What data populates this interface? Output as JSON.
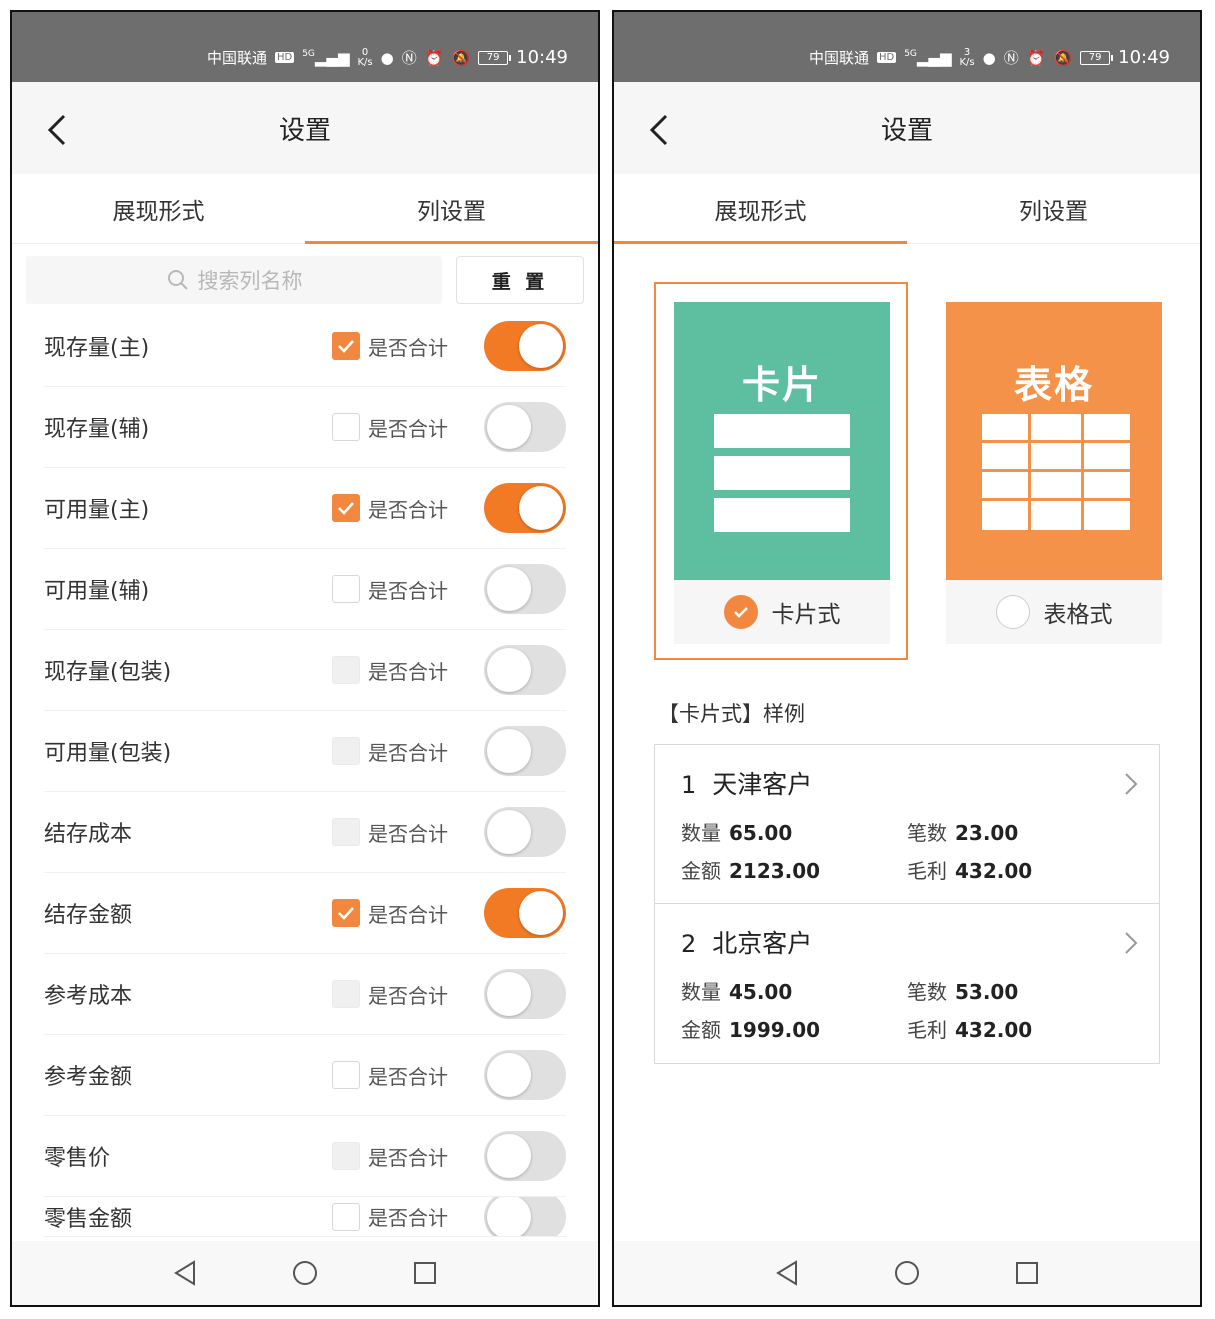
{
  "status_bar": {
    "carrier": "中国联通",
    "hd": "HD",
    "net": "5G",
    "left_speed_top": "0",
    "right_speed_top": "3",
    "speed_unit": "K/s",
    "battery": "79",
    "time": "10:49"
  },
  "header": {
    "title": "设置"
  },
  "tabs": {
    "display_mode": "展现形式",
    "column_settings": "列设置"
  },
  "column_settings": {
    "search_placeholder": "搜索列名称",
    "reset_label": "重 置",
    "sum_label": "是否合计",
    "columns": [
      {
        "name": "现存量(主)",
        "sum": "checked",
        "enabled": true
      },
      {
        "name": "现存量(辅)",
        "sum": "unchecked",
        "enabled": false
      },
      {
        "name": "可用量(主)",
        "sum": "checked",
        "enabled": true
      },
      {
        "name": "可用量(辅)",
        "sum": "unchecked",
        "enabled": false
      },
      {
        "name": "现存量(包装)",
        "sum": "disabled",
        "enabled": false
      },
      {
        "name": "可用量(包装)",
        "sum": "disabled",
        "enabled": false
      },
      {
        "name": "结存成本",
        "sum": "disabled",
        "enabled": false
      },
      {
        "name": "结存金额",
        "sum": "checked",
        "enabled": true
      },
      {
        "name": "参考成本",
        "sum": "disabled",
        "enabled": false
      },
      {
        "name": "参考金额",
        "sum": "unchecked",
        "enabled": false
      },
      {
        "name": "零售价",
        "sum": "disabled",
        "enabled": false
      },
      {
        "name": "零售金额",
        "sum": "unchecked",
        "enabled": false
      }
    ]
  },
  "display_mode": {
    "options": [
      {
        "image_title": "卡片",
        "label": "卡片式",
        "selected": true
      },
      {
        "image_title": "表格",
        "label": "表格式",
        "selected": false
      }
    ],
    "sample_title": "【卡片式】样例",
    "samples": [
      {
        "index": "1",
        "name": "天津客户",
        "qty_label": "数量",
        "qty": "65.00",
        "count_label": "笔数",
        "count": "23.00",
        "amount_label": "金额",
        "amount": "2123.00",
        "profit_label": "毛利",
        "profit": "432.00"
      },
      {
        "index": "2",
        "name": "北京客户",
        "qty_label": "数量",
        "qty": "45.00",
        "count_label": "笔数",
        "count": "53.00",
        "amount_label": "金额",
        "amount": "1999.00",
        "profit_label": "毛利",
        "profit": "432.00"
      }
    ]
  },
  "colors": {
    "accent": "#f2883f",
    "teal": "#5dbfa0",
    "toggle_on": "#f27a25"
  }
}
